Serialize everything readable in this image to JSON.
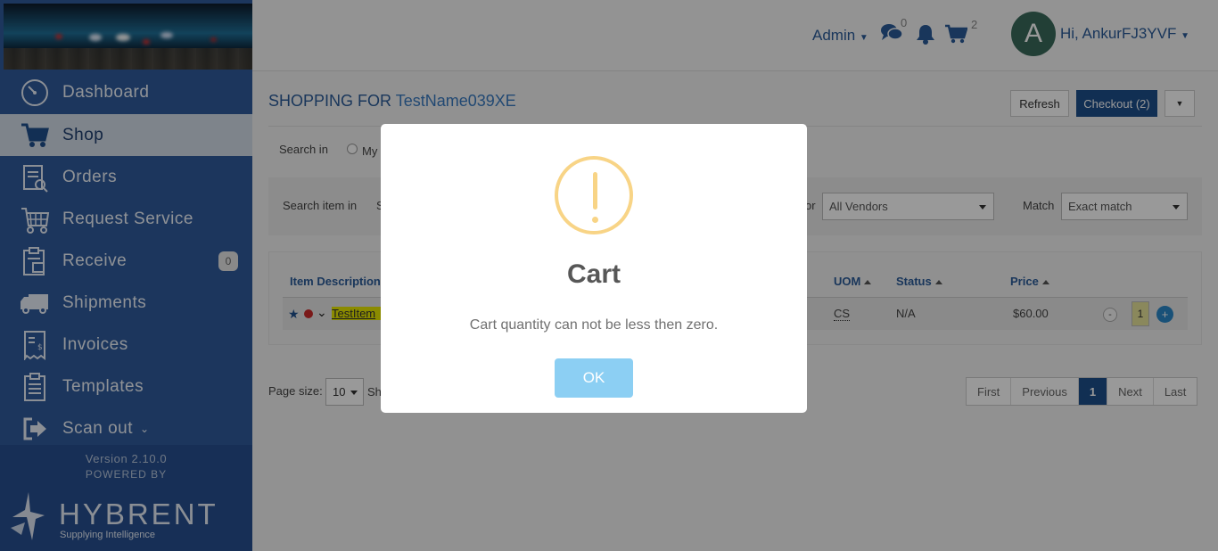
{
  "app": {
    "version": "Version 2.10.0",
    "powered_by": "POWERED BY",
    "brand_name": "HYBRENT",
    "brand_tagline": "Supplying Intelligence"
  },
  "topbar": {
    "admin_label": "Admin",
    "messages_count": "0",
    "cart_count": "2",
    "avatar_letter": "A",
    "greeting": "Hi, AnkurFJ3YVF"
  },
  "sidebar": {
    "items": [
      {
        "label": "Dashboard",
        "icon": "dashboard-icon"
      },
      {
        "label": "Shop",
        "icon": "cart-icon",
        "active": true
      },
      {
        "label": "Orders",
        "icon": "orders-icon"
      },
      {
        "label": "Request Service",
        "icon": "request-service-icon"
      },
      {
        "label": "Receive",
        "icon": "receive-icon",
        "badge": "0"
      },
      {
        "label": "Shipments",
        "icon": "truck-icon"
      },
      {
        "label": "Invoices",
        "icon": "invoice-icon"
      },
      {
        "label": "Templates",
        "icon": "templates-icon"
      },
      {
        "label": "Scan out",
        "icon": "scan-out-icon"
      }
    ]
  },
  "main": {
    "title_prefix": "SHOPPING FOR",
    "customer_name": "TestName039XE",
    "refresh_label": "Refresh",
    "checkout_label": "Checkout (2)",
    "search_in_label": "Search in",
    "search_in_option": "My",
    "search_item_label": "Search item in",
    "search_item_value": "S",
    "vendor_label_partial": "or",
    "vendor_select": "All Vendors",
    "match_label": "Match",
    "match_select": "Exact match",
    "table": {
      "headers": [
        "Item Description",
        "UOM",
        "Status",
        "Price"
      ],
      "row": {
        "item": "TestItem",
        "uom": "CS",
        "status": "N/A",
        "price": "$60.00",
        "qty_minus": "-",
        "qty": "1",
        "qty_plus": "+"
      }
    },
    "page_size_label": "Page size:",
    "page_size_value": "10",
    "showing_partial": "Sh",
    "pager": [
      "First",
      "Previous",
      "1",
      "Next",
      "Last"
    ]
  },
  "modal": {
    "title": "Cart",
    "message": "Cart quantity can not be less then zero.",
    "ok_label": "OK",
    "icon": "warning-icon",
    "accent_color": "#f8d486",
    "button_color": "#8ccff3"
  }
}
